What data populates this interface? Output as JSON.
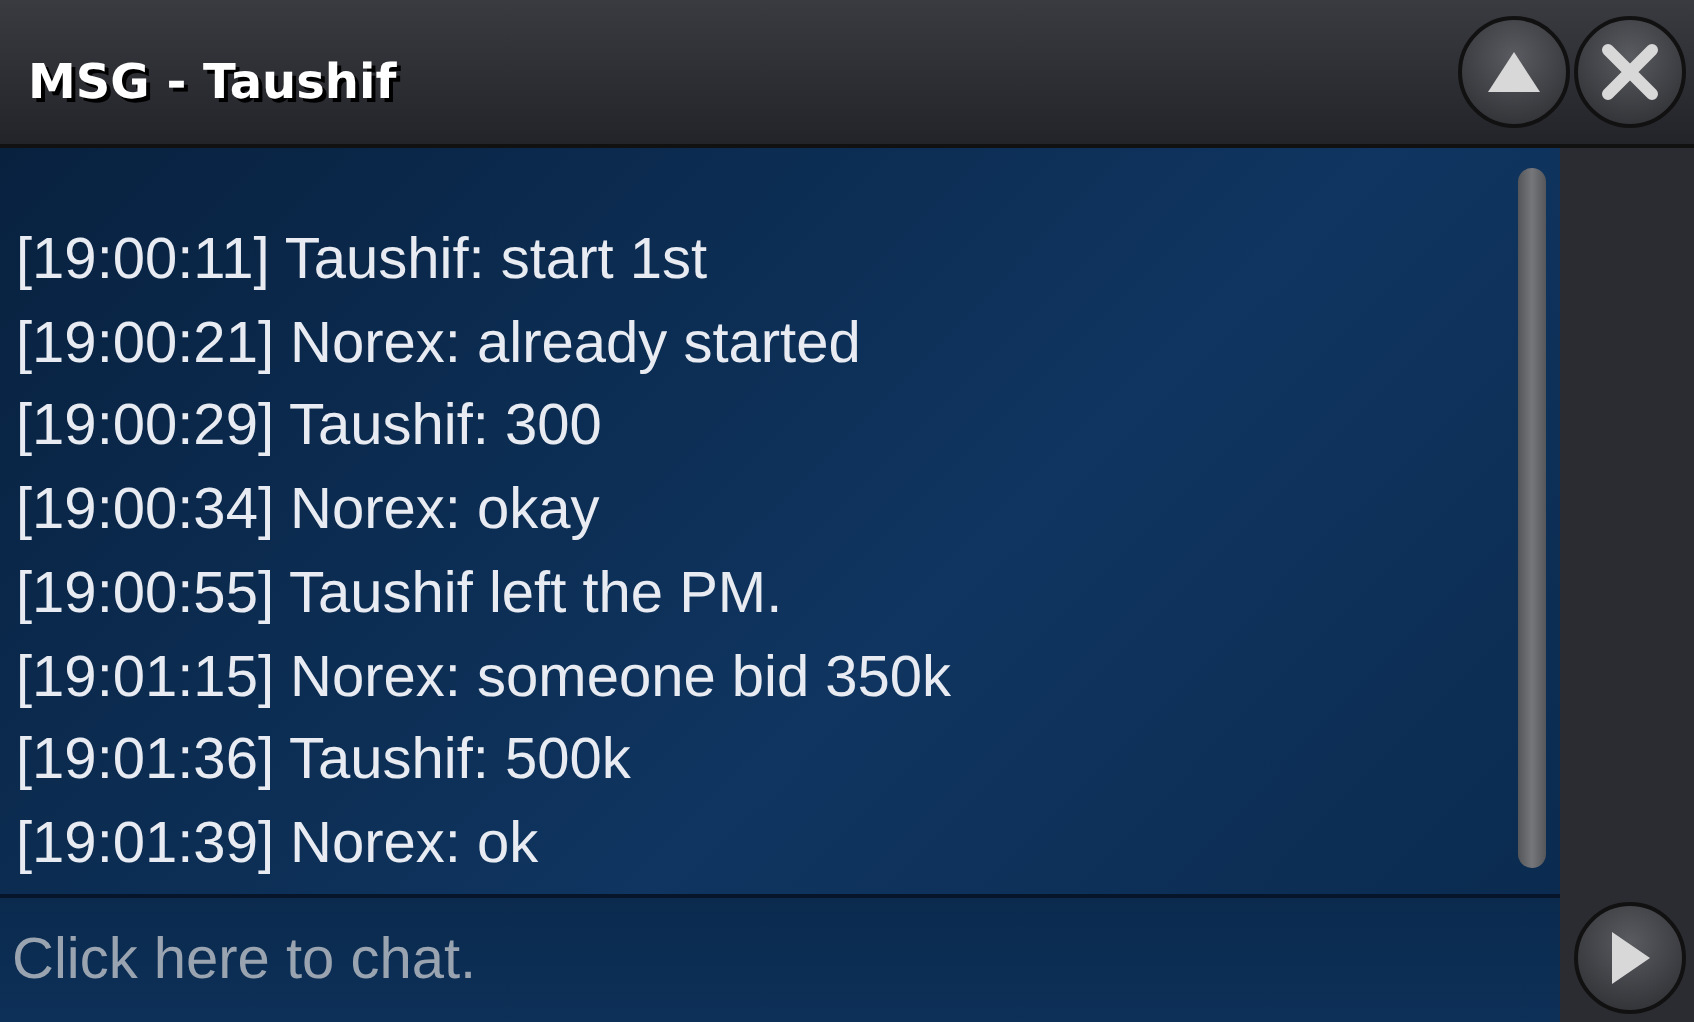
{
  "window": {
    "title": "MSG - Taushif"
  },
  "messages": [
    "[19:00:11] Taushif: start 1st",
    "[19:00:21] Norex: already started",
    "[19:00:29] Taushif: 300",
    "[19:00:34] Norex: okay",
    "[19:00:55] Taushif left the PM.",
    "[19:01:15] Norex: someone bid 350k",
    "[19:01:36] Taushif: 500k",
    "[19:01:39] Norex: ok"
  ],
  "chat_input": {
    "placeholder": "Click here to chat."
  }
}
